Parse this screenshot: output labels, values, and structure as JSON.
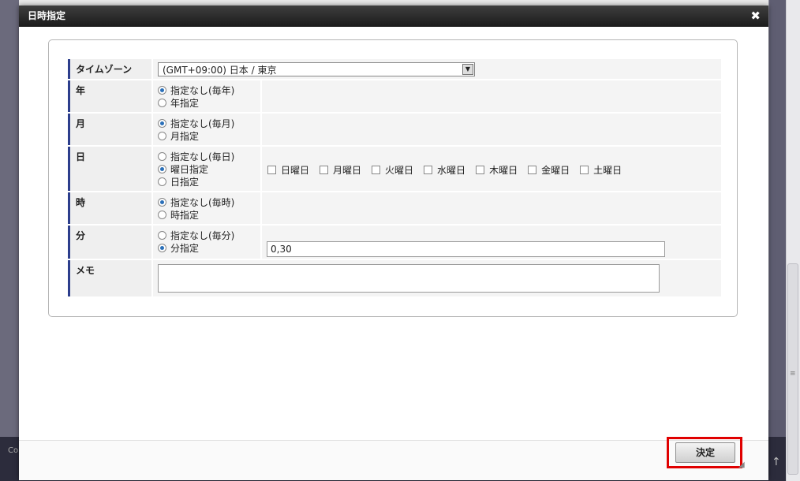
{
  "dialog": {
    "title": "日時指定",
    "close_icon": "close-icon"
  },
  "timezone": {
    "label": "タイムゾーン",
    "selected": "(GMT+09:00) 日本 / 東京"
  },
  "year": {
    "label": "年",
    "options": [
      "指定なし(毎年)",
      "年指定"
    ],
    "selected_index": 0
  },
  "month": {
    "label": "月",
    "options": [
      "指定なし(毎月)",
      "月指定"
    ],
    "selected_index": 0
  },
  "day": {
    "label": "日",
    "options": [
      "指定なし(毎日)",
      "曜日指定",
      "日指定"
    ],
    "selected_index": 1,
    "weekdays": [
      "日曜日",
      "月曜日",
      "火曜日",
      "水曜日",
      "木曜日",
      "金曜日",
      "土曜日"
    ]
  },
  "hour": {
    "label": "時",
    "options": [
      "指定なし(毎時)",
      "時指定"
    ],
    "selected_index": 0
  },
  "minute": {
    "label": "分",
    "options": [
      "指定なし(毎分)",
      "分指定"
    ],
    "selected_index": 1,
    "value": "0,30"
  },
  "memo": {
    "label": "メモ",
    "value": ""
  },
  "footer": {
    "ok_label": "決定"
  },
  "background": {
    "footer_text": "Co",
    "scroll_up_icon": "↑"
  },
  "colors": {
    "label_accent": "#2c3e8c",
    "highlight": "#e00000",
    "radio_dot": "#2a6fb8"
  }
}
